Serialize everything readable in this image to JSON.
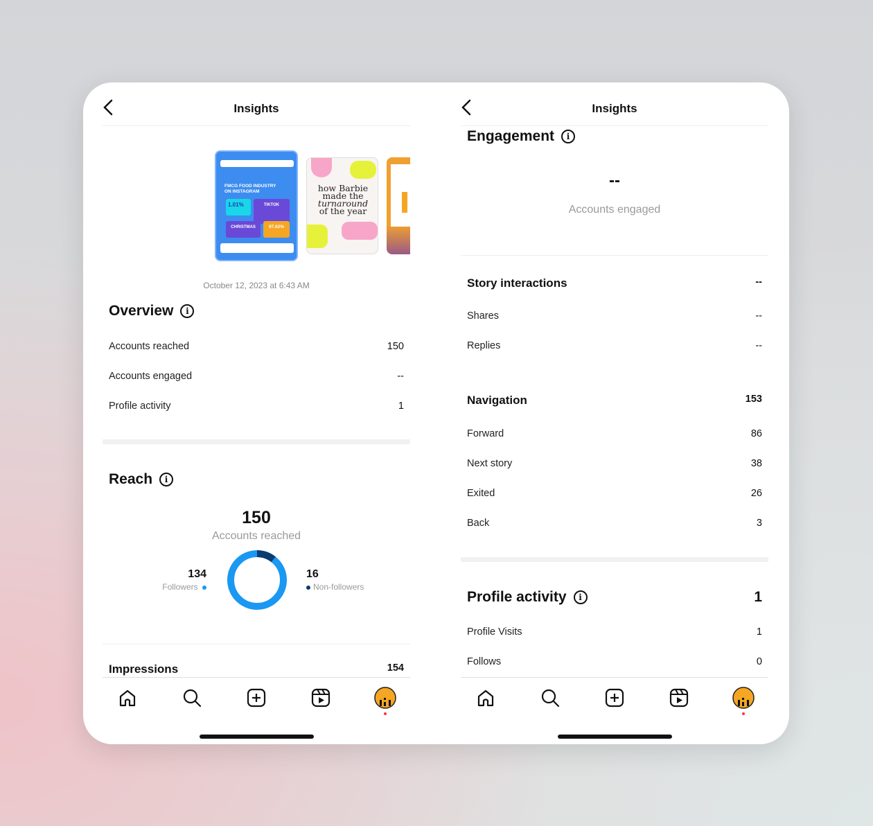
{
  "left": {
    "title": "Insights",
    "stories": [
      {
        "lines": [
          "FMCG FOOD INDUSTRY",
          "ON INSTAGRAM"
        ],
        "tiles": [
          "1.01%",
          "TIKTOK",
          "CHRISTMAS",
          "97.62%"
        ]
      },
      {
        "lines": [
          "how Barbie",
          "made the",
          "turnaround",
          "of the year"
        ]
      },
      {}
    ],
    "timestamp": "October 12, 2023 at 6:43 AM",
    "overview": {
      "title": "Overview",
      "rows": [
        {
          "label": "Accounts reached",
          "value": "150"
        },
        {
          "label": "Accounts engaged",
          "value": "--"
        },
        {
          "label": "Profile activity",
          "value": "1"
        }
      ]
    },
    "reach": {
      "title": "Reach",
      "total": "150",
      "total_label": "Accounts reached",
      "followers": {
        "value": "134",
        "label": "Followers",
        "color": "#1a98f2"
      },
      "non_followers": {
        "value": "16",
        "label": "Non-followers",
        "color": "#0b3b70"
      }
    },
    "impressions": {
      "label": "Impressions",
      "value": "154"
    }
  },
  "right": {
    "title": "Insights",
    "engagement": {
      "title": "Engagement",
      "value": "--",
      "label": "Accounts engaged"
    },
    "story_interactions": {
      "title": "Story interactions",
      "value": "--",
      "rows": [
        {
          "label": "Shares",
          "value": "--"
        },
        {
          "label": "Replies",
          "value": "--"
        }
      ]
    },
    "navigation": {
      "title": "Navigation",
      "value": "153",
      "rows": [
        {
          "label": "Forward",
          "value": "86"
        },
        {
          "label": "Next story",
          "value": "38"
        },
        {
          "label": "Exited",
          "value": "26"
        },
        {
          "label": "Back",
          "value": "3"
        }
      ]
    },
    "profile_activity": {
      "title": "Profile activity",
      "value": "1",
      "rows": [
        {
          "label": "Profile Visits",
          "value": "1"
        },
        {
          "label": "Follows",
          "value": "0"
        }
      ]
    }
  },
  "bottom_nav": [
    "home-icon",
    "search-icon",
    "create-icon",
    "reels-icon",
    "profile-avatar"
  ],
  "colors": {
    "notification_dot": "#ff3040",
    "avatar": "#f5a623"
  }
}
